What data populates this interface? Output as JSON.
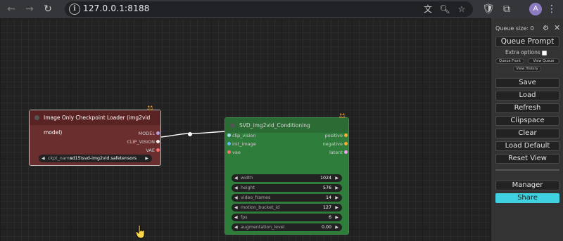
{
  "browser": {
    "url": "127.0.0.1:8188",
    "profile_initial": "A"
  },
  "nodes": {
    "loader": {
      "title": "Image Only Checkpoint Loader (img2vid model)",
      "outputs": [
        "MODEL",
        "CLIP_VISION",
        "VAE"
      ],
      "widget_label": "ckpt_name",
      "widget_value": "sd15\\svd-img2vid.safetensors"
    },
    "svd": {
      "title": "SVD_img2vid_Conditioning",
      "inputs": [
        "clip_vision",
        "init_image",
        "vae"
      ],
      "outputs": [
        "positive",
        "negative",
        "latent"
      ],
      "widgets": [
        {
          "label": "width",
          "value": "1024"
        },
        {
          "label": "height",
          "value": "576"
        },
        {
          "label": "video_frames",
          "value": "14"
        },
        {
          "label": "motion_bucket_id",
          "value": "127"
        },
        {
          "label": "fps",
          "value": "6"
        },
        {
          "label": "augmentation_level",
          "value": "0.00"
        }
      ]
    }
  },
  "menu": {
    "queue_size": "Queue size: 0",
    "queue_prompt": "Queue Prompt",
    "extra_options": "Extra options",
    "queue_front": "Queue Front",
    "view_queue": "View Queue",
    "view_history": "View History",
    "save": "Save",
    "load": "Load",
    "refresh": "Refresh",
    "clipspace": "Clipspace",
    "clear": "Clear",
    "load_default": "Load Default",
    "reset_view": "Reset View",
    "manager": "Manager",
    "share": "Share"
  },
  "colors": {
    "loader_body": "#6b2e2e",
    "svd_body": "#2f7d3a",
    "share_button": "#3fd1e0",
    "port_clip_vision": "#a1d8f0",
    "port_image": "#64b5f6",
    "port_vae": "#ff6e6e",
    "port_conditioning": "#ffa931",
    "port_latent": "#ff9cf9",
    "port_model": "#b39ddb"
  }
}
